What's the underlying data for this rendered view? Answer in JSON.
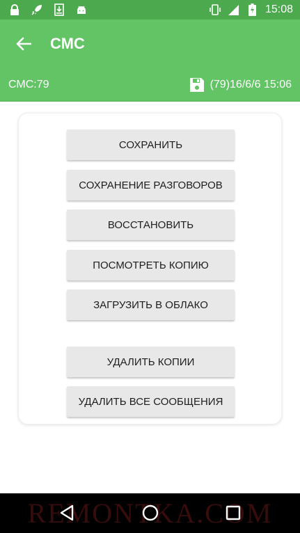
{
  "status_bar": {
    "time": "15:08",
    "icons_left": [
      "lock-icon",
      "rocket-icon",
      "download-icon",
      "android-icon"
    ],
    "icons_right": [
      "vibrate-icon",
      "signal-icon",
      "battery-charging-icon"
    ]
  },
  "app_bar": {
    "title": "СМС",
    "back_icon": "arrow-back-icon"
  },
  "info_bar": {
    "sms_count": "СМС:79",
    "backup_icon": "floppy-disk-icon",
    "backup_info": "(79)16/6/6 15:06"
  },
  "buttons": {
    "save": "СОХРАНИТЬ",
    "save_conversations": "СОХРАНЕНИЕ РАЗГОВОРОВ",
    "restore": "ВОССТАНОВИТЬ",
    "view_copy": "ПОСМОТРЕТЬ КОПИЮ",
    "upload_cloud": "ЗАГРУЗИТЬ В ОБЛАКО",
    "delete_copies": "УДАЛИТЬ КОПИИ",
    "delete_all_messages": "УДАЛИТЬ ВСЕ СООБЩЕНИЯ"
  },
  "nav_bar": {
    "watermark": "REMONTKA.COM",
    "icons": [
      "back-triangle-icon",
      "home-circle-icon",
      "recents-square-icon"
    ]
  },
  "colors": {
    "status_bar": "#4ca94e",
    "app_bar": "#63c466",
    "button_bg": "#e8e8e8",
    "nav_bar": "#000000"
  }
}
